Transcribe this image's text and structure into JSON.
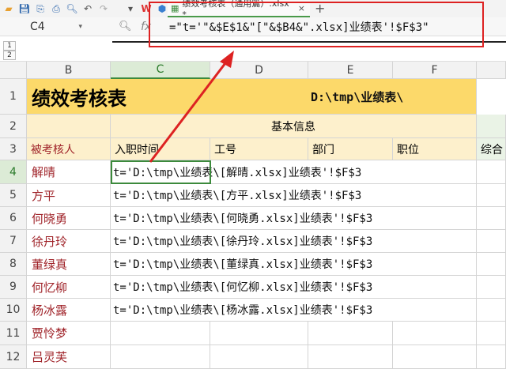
{
  "toolbar": {
    "icons": [
      "open-folder-icon",
      "save-icon",
      "export-icon",
      "print-icon",
      "print-preview-icon",
      "undo-icon",
      "redo-icon",
      "dropdown-icon",
      "wps-logo-icon",
      "cube-icon"
    ]
  },
  "tab": {
    "title": "绩效考核表（通用篇）.xlsx *",
    "close": "×",
    "add": "+"
  },
  "formula_bar": {
    "cell_ref": "C4",
    "fx": "fx",
    "formula": "=\"t='\"&$E$1&\"[\"&$B4&\".xlsx]业绩表'!$F$3\""
  },
  "outline": {
    "levels": [
      "1",
      "2"
    ]
  },
  "columns": [
    "B",
    "C",
    "D",
    "E",
    "F"
  ],
  "rows": [
    "1",
    "2",
    "3",
    "4",
    "5",
    "6",
    "7",
    "8",
    "9",
    "10",
    "11",
    "12"
  ],
  "sheet": {
    "title": "绩效考核表",
    "path": "D:\\tmp\\业绩表\\",
    "group_header": "基本信息",
    "headers": [
      "被考核人",
      "入职时间",
      "工号",
      "部门",
      "职位",
      "综合"
    ],
    "employees": [
      {
        "name": "解晴",
        "value": "t='D:\\tmp\\业绩表\\[解晴.xlsx]业绩表'!$F$3"
      },
      {
        "name": "方平",
        "value": "t='D:\\tmp\\业绩表\\[方平.xlsx]业绩表'!$F$3"
      },
      {
        "name": "何晓勇",
        "value": "t='D:\\tmp\\业绩表\\[何晓勇.xlsx]业绩表'!$F$3"
      },
      {
        "name": "徐丹玲",
        "value": "t='D:\\tmp\\业绩表\\[徐丹玲.xlsx]业绩表'!$F$3"
      },
      {
        "name": "董绿真",
        "value": "t='D:\\tmp\\业绩表\\[董绿真.xlsx]业绩表'!$F$3"
      },
      {
        "name": "何忆柳",
        "value": "t='D:\\tmp\\业绩表\\[何忆柳.xlsx]业绩表'!$F$3"
      },
      {
        "name": "杨冰露",
        "value": "t='D:\\tmp\\业绩表\\[杨冰露.xlsx]业绩表'!$F$3"
      },
      {
        "name": "贾怜梦",
        "value": ""
      },
      {
        "name": "吕灵芙",
        "value": ""
      }
    ]
  },
  "colors": {
    "title_bg": "#fcd96a",
    "header_bg": "#fdf0cc",
    "name_color": "#a0242a",
    "annotation": "#dd2222",
    "selection": "#3c8a3c"
  }
}
